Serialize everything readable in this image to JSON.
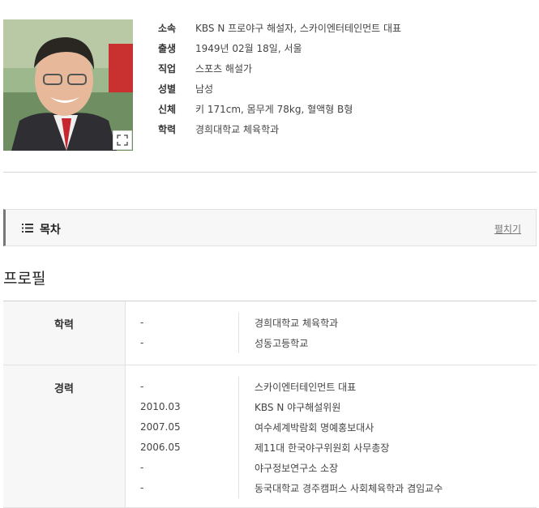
{
  "person": {
    "info": [
      {
        "key": "소속",
        "value": "KBS N 프로야구 해설자, 스카이엔터테인먼트 대표"
      },
      {
        "key": "출생",
        "value": "1949년 02월 18일, 서울"
      },
      {
        "key": "직업",
        "value": "스포츠 해설가"
      },
      {
        "key": "성별",
        "value": "남성"
      },
      {
        "key": "신체",
        "value": "키 171cm, 몸무게 78kg, 혈액형 B형"
      },
      {
        "key": "학력",
        "value": "경희대학교 체육학과"
      }
    ]
  },
  "toc": {
    "title": "목차",
    "toggle_label": "펼치기",
    "icon": "list-icon"
  },
  "section": {
    "title": "프로필"
  },
  "profile": {
    "education": {
      "label": "학력",
      "rows": [
        {
          "date": "-",
          "text": "경희대학교 체육학과"
        },
        {
          "date": "-",
          "text": "성동고등학교"
        }
      ]
    },
    "career": {
      "label": "경력",
      "rows": [
        {
          "date": "-",
          "text": "스카이엔터테인먼트 대표"
        },
        {
          "date": "2010.03",
          "text": "KBS N 야구해설위원"
        },
        {
          "date": "2007.05",
          "text": "여수세계박람회 명예홍보대사"
        },
        {
          "date": "2006.05",
          "text": "제11대 한국야구위원회 사무총장"
        },
        {
          "date": "-",
          "text": "야구정보연구소 소장"
        },
        {
          "date": "-",
          "text": "동국대학교 경주캠퍼스 사회체육학과 겸임교수"
        }
      ]
    }
  }
}
